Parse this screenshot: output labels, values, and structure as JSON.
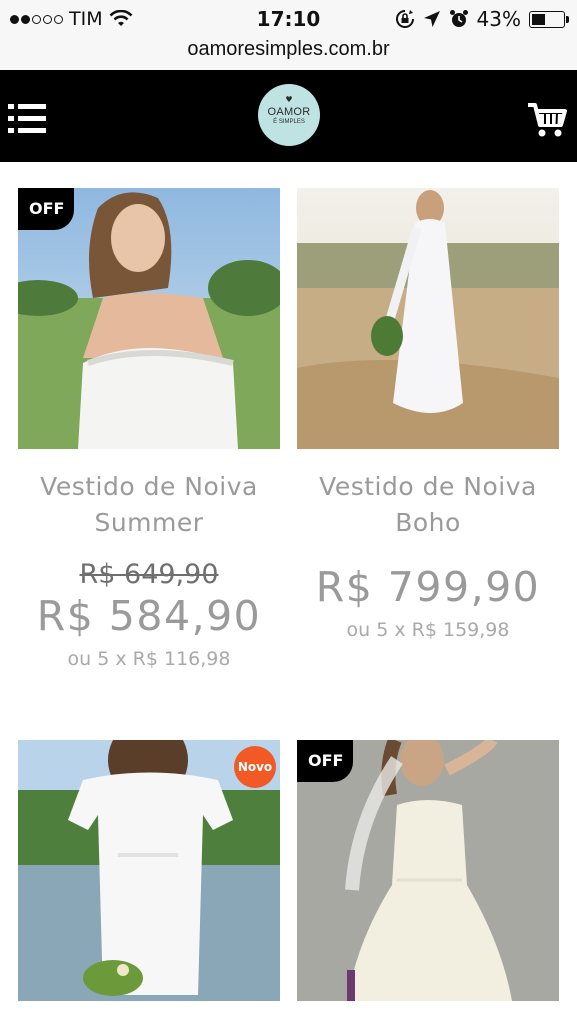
{
  "status_bar": {
    "carrier": "TIM",
    "signal_bars_filled": 2,
    "signal_bars_total": 5,
    "time": "17:10",
    "battery": "43%",
    "battery_level": 0.43
  },
  "browser": {
    "url": "oamoresimples.com.br"
  },
  "header": {
    "menu_icon": "hamburger-list-icon",
    "logo_line1": "OAMOR",
    "logo_line2": "É SIMPLES",
    "logo_color": "#bfe3e3",
    "cart_icon": "shopping-cart-icon"
  },
  "products": [
    {
      "name_line1": "Vestido de Noiva",
      "name_line2": "Summer",
      "badge": "OFF",
      "old_price": "R$ 649,90",
      "price": "R$ 584,90",
      "installments": "ou 5 x R$ 116,98"
    },
    {
      "name_line1": "Vestido de Noiva",
      "name_line2": "Boho",
      "price": "R$ 799,90",
      "installments": "ou 5 x R$ 159,98"
    },
    {
      "badge": "Novo",
      "badge_color": "#f15a24"
    },
    {
      "badge": "OFF"
    }
  ]
}
